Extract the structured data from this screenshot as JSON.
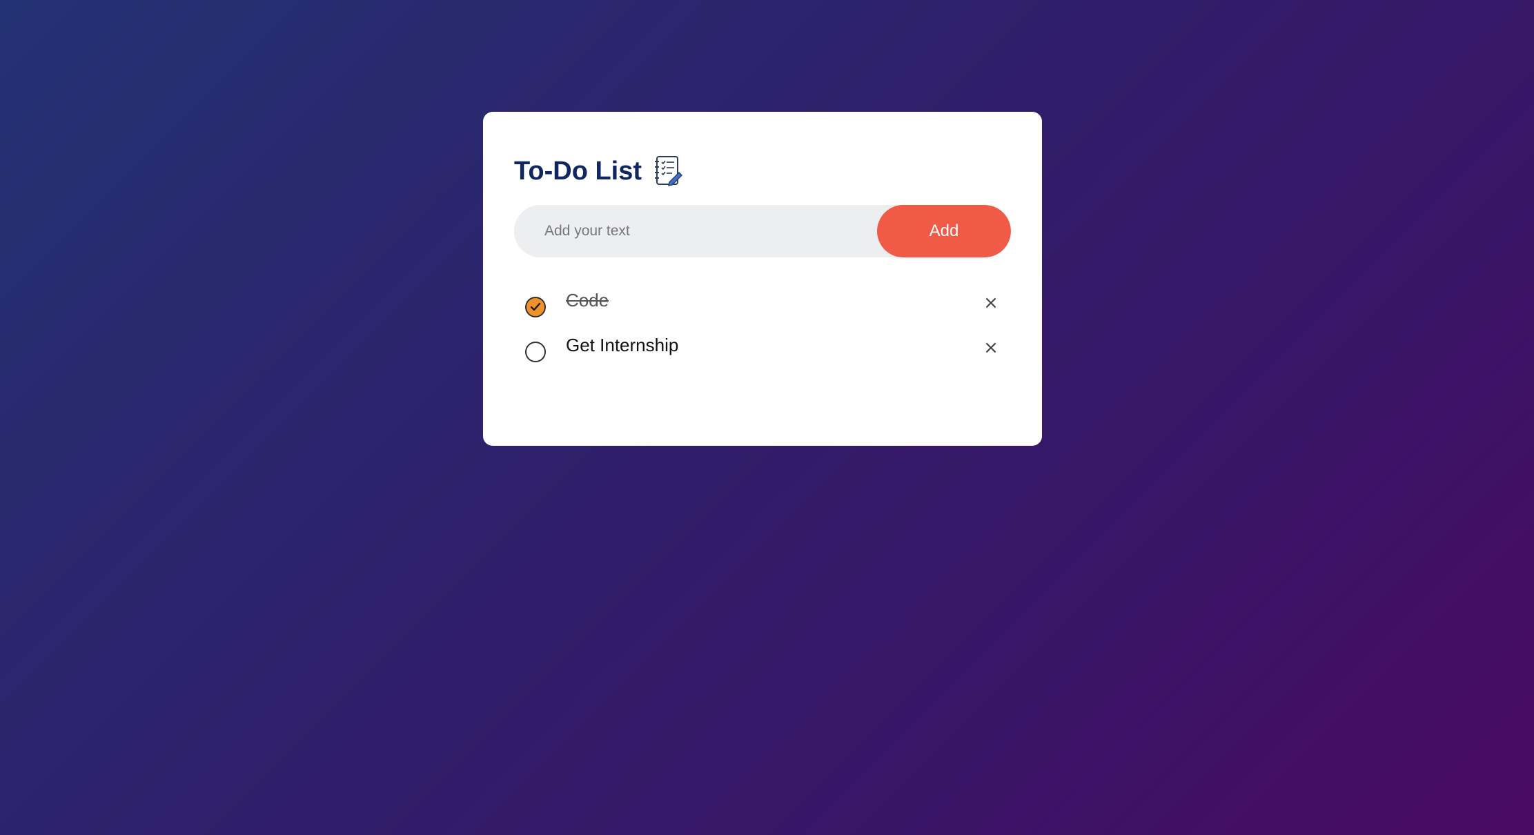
{
  "app": {
    "title": "To-Do List",
    "title_icon": "notebook-checklist-icon"
  },
  "input": {
    "placeholder": "Add your text",
    "value": ""
  },
  "add_button": {
    "label": "Add"
  },
  "tasks": [
    {
      "text": "Code",
      "completed": true
    },
    {
      "text": "Get Internship",
      "completed": false
    }
  ],
  "delete_icon": {
    "glyph": "×",
    "name": "close-icon"
  },
  "colors": {
    "title": "#0f2660",
    "add_button": "#f05b48",
    "check_fill": "#f0922a",
    "card": "#ffffff",
    "input_bg": "#edeef0"
  }
}
